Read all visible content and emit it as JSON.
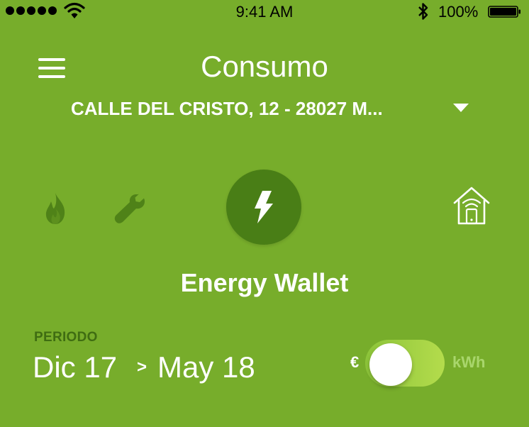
{
  "status_bar": {
    "time": "9:41 AM",
    "battery_percent": "100%",
    "signal_bars": 5
  },
  "header": {
    "menu_icon": "hamburger-menu-icon",
    "title": "Consumo",
    "address": "CALLE DEL CRISTO, 12 - 28027 M...",
    "address_dropdown_icon": "caret-down-icon"
  },
  "services": [
    {
      "icon": "flame-icon",
      "selected": false
    },
    {
      "icon": "wrench-icon",
      "selected": false
    },
    {
      "icon": "lightning-bolt-icon",
      "selected": true
    },
    {
      "icon": "smart-home-icon",
      "selected": false
    }
  ],
  "section_title": "Energy Wallet",
  "period": {
    "label": "PERIODO",
    "from": "Dic 17",
    "arrow": ">",
    "to": "May 18"
  },
  "unit_toggle": {
    "left_label": "€",
    "right_label": "kWh",
    "selected": "€"
  },
  "colors": {
    "background": "#77AD2B",
    "active_circle": "#497E16",
    "inactive_icon": "#4F8218",
    "period_label": "#3F6D12"
  }
}
